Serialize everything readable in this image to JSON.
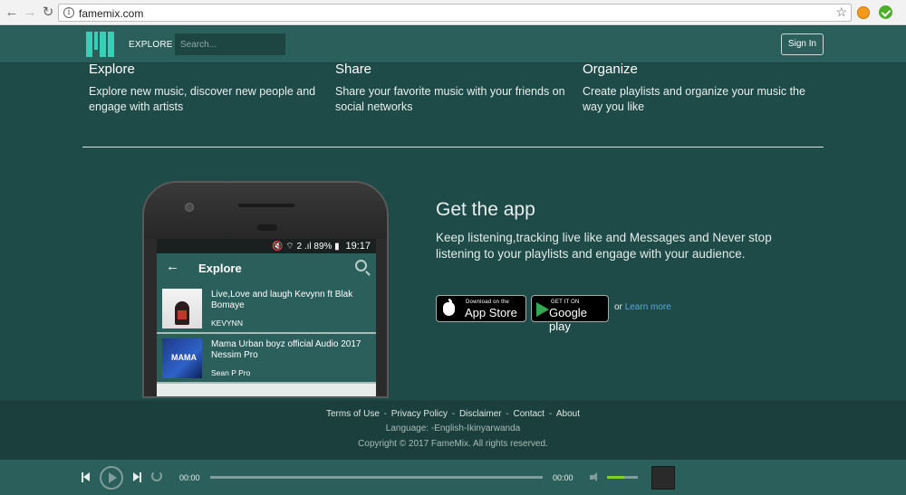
{
  "browser": {
    "url": "famemix.com"
  },
  "header": {
    "explore_label": "EXPLORE",
    "search_placeholder": "Search...",
    "signin_label": "Sign In"
  },
  "features": [
    {
      "title": "Explore",
      "text": "Explore new music, discover new people and engage with artists"
    },
    {
      "title": "Share",
      "text": "Share your favorite music with your friends on social networks"
    },
    {
      "title": "Organize",
      "text": "Create playlists and organize your music the way you like"
    }
  ],
  "phone": {
    "status_icons": "🔇 ⌔ 2 .ıl 89% ▮",
    "time": "19:17",
    "screen_title": "Explore",
    "tracks": [
      {
        "title": "Live,Love and laugh Kevynn ft Blak Bomaye",
        "artist": "KEVYNN"
      },
      {
        "title": "Mama  Urban boyz official Audio 2017 Nessim Pro",
        "artist": "Sean P Pro",
        "thumb_label": "MAMA"
      }
    ]
  },
  "get_app": {
    "title": "Get the app",
    "description": "Keep listening,tracking live like and Messages and Never stop listening to your playlists and engage with your audience.",
    "appstore_small": "Download on the",
    "appstore_big": "App Store",
    "googleplay_small": "GET IT ON",
    "googleplay_big": "Google play",
    "or_text": "or",
    "learn_more": "Learn more"
  },
  "footer": {
    "links": [
      "Terms of Use",
      "Privacy Policy",
      "Disclaimer",
      "Contact",
      "About"
    ],
    "language_label": "Language:",
    "language_value": "-English-Ikinyarwanda",
    "copyright": "Copyright © 2017 FameMix. All rights reserved."
  },
  "player": {
    "current_time": "00:00",
    "duration": "00:00",
    "progress": 0,
    "volume": 0.55
  },
  "colors": {
    "header_bg": "#2b5f5b",
    "page_bg": "#1e4a47",
    "footer_bg": "#1a3f3c",
    "logo": "#35d0b5",
    "link": "#5aa7e0",
    "volume_fill": "#7ed321"
  },
  "icons": [
    "back-arrow-icon",
    "forward-arrow-icon",
    "reload-icon",
    "info-icon",
    "star-icon",
    "apple-icon",
    "google-play-icon",
    "search-icon",
    "prev-icon",
    "play-icon",
    "next-icon",
    "repeat-icon",
    "volume-icon"
  ]
}
